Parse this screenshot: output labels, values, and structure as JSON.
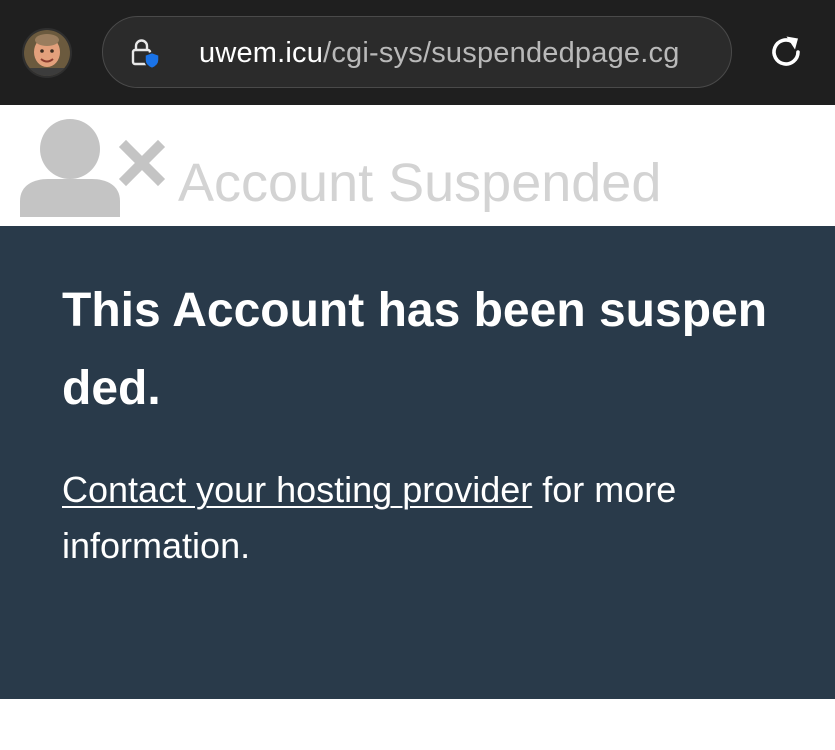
{
  "browser": {
    "url_host": "uwem.icu",
    "url_path": "/cgi-sys/suspendedpage.cg",
    "icons": {
      "avatar": "profile-avatar",
      "lock": "lock-shield-icon",
      "reload": "reload-icon"
    },
    "colors": {
      "bar_background": "#1f1f1f",
      "pill_background": "#2b2b2b",
      "shield_accent": "#1a73e8"
    }
  },
  "page": {
    "title": "Account Suspended",
    "title_icon": "user-x-icon",
    "heading": "This Account has been suspended.",
    "contact_link": "Contact your hosting provider",
    "contact_suffix": " for more information.",
    "colors": {
      "panel_background": "#293a4a",
      "title_color": "#d3d3d3",
      "icon_color": "#c4c4c4"
    }
  }
}
